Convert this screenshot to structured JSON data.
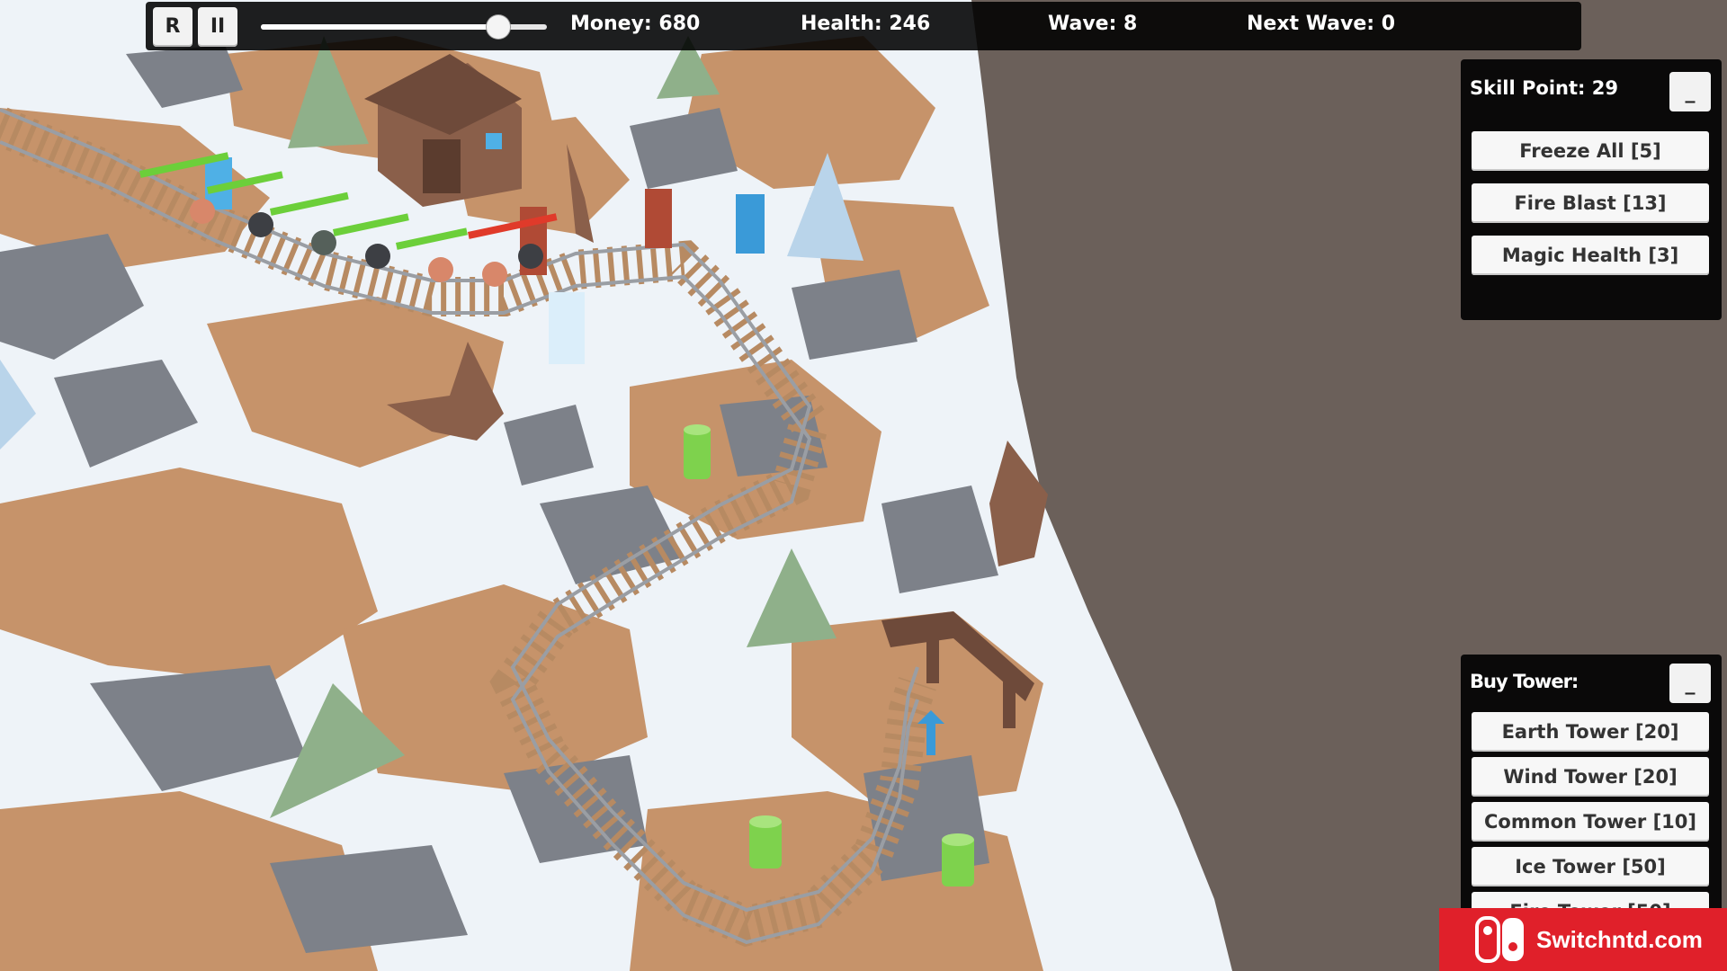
{
  "hud": {
    "restart_label": "R",
    "pause_label": "II",
    "speed_level": 0.83,
    "money": "Money: 680",
    "health": "Health: 246",
    "wave": "Wave: 8",
    "next_wave": "Next Wave: 0"
  },
  "skills": {
    "title": "Skill Point: 29",
    "minimize_label": "_",
    "buttons": [
      {
        "label": "Freeze All [5]"
      },
      {
        "label": "Fire Blast [13]"
      },
      {
        "label": "Magic Health [3]"
      }
    ]
  },
  "buy": {
    "title": "Buy Tower:",
    "minimize_label": "_",
    "buttons": [
      {
        "label": "Earth Tower [20]"
      },
      {
        "label": "Wind Tower [20]"
      },
      {
        "label": "Common Tower [10]"
      },
      {
        "label": "Ice Tower [50]"
      },
      {
        "label": "Fire Tower [50]"
      }
    ]
  },
  "watermark": {
    "text": "Switchntd.com"
  },
  "colors": {
    "snow": "#eef3f8",
    "dirt": "#c6936a",
    "rock": "#7d8189",
    "void": "#6b605a",
    "track": "#b78a62",
    "pine": "#8fb08a",
    "ice_pine": "#b9d4ea",
    "earth_tower": "#7ed24d",
    "fire_tower": "#b04a35",
    "wind_tower": "#3a9ad8",
    "watermark_red": "#e0202a"
  }
}
